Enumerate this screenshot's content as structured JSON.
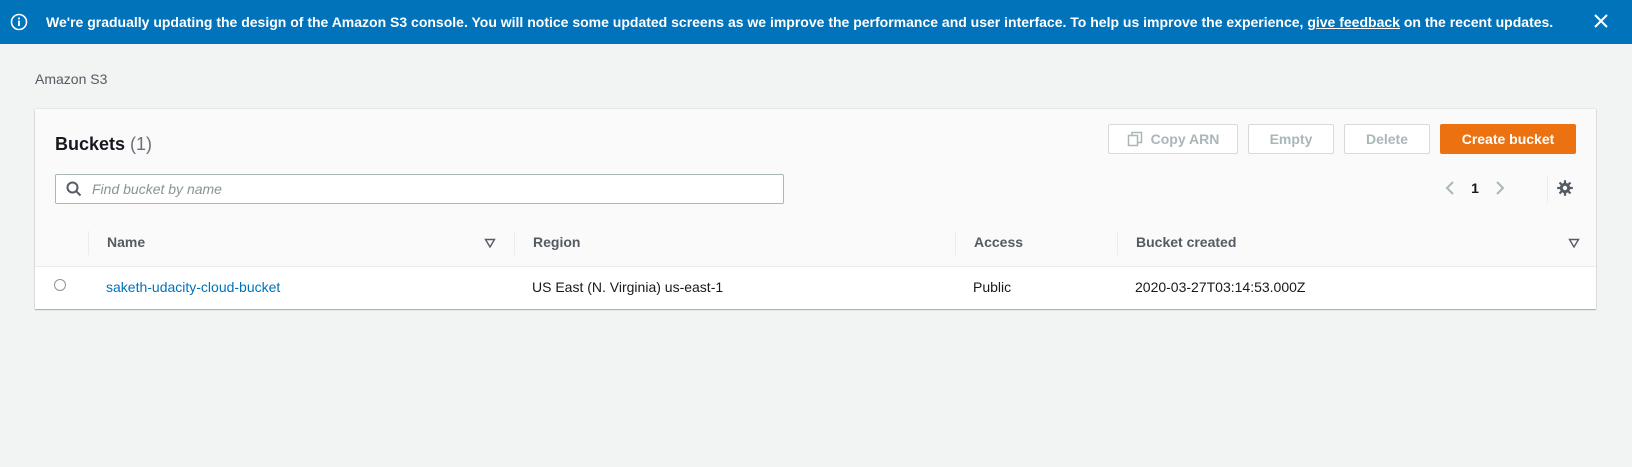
{
  "banner": {
    "message_before": "We're gradually updating the design of the Amazon S3 console. You will notice some updated screens as we improve the performance and user interface. To help us improve the experience,",
    "link_text": "give feedback",
    "message_after": "on the recent updates.",
    "icons": {
      "info": "info-icon",
      "close": "close-icon"
    }
  },
  "breadcrumb": "Amazon S3",
  "buckets": {
    "title": "Buckets",
    "count": "(1)",
    "actions": {
      "copy_arn": "Copy ARN",
      "empty": "Empty",
      "delete": "Delete",
      "create": "Create bucket"
    },
    "search": {
      "placeholder": "Find bucket by name",
      "value": ""
    },
    "pagination": {
      "current_page": "1"
    },
    "columns": [
      "Name",
      "Region",
      "Access",
      "Bucket created"
    ],
    "rows": [
      {
        "name": "saketh-udacity-cloud-bucket",
        "region": "US East (N. Virginia) us-east-1",
        "access": "Public",
        "created": "2020-03-27T03:14:53.000Z"
      }
    ]
  },
  "colors": {
    "banner": "#0073bb",
    "primary_button": "#ec7211",
    "link": "#0073bb",
    "background": "#f2f3f3"
  }
}
